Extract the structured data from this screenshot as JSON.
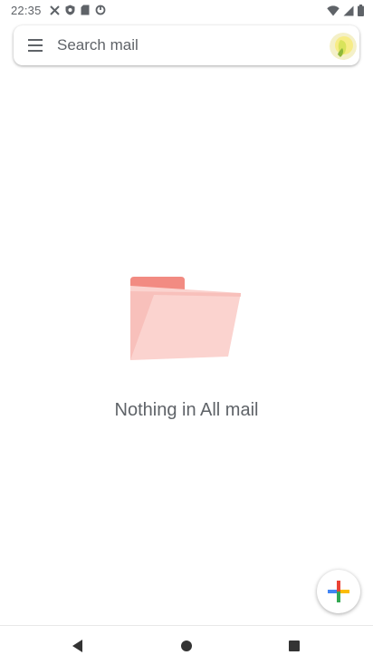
{
  "status_bar": {
    "time": "22:35",
    "left_icons": [
      "missed-call-icon",
      "shield-icon",
      "sd-card-icon",
      "sync-icon"
    ],
    "right_icons": [
      "wifi-icon",
      "signal-icon",
      "battery-icon"
    ]
  },
  "search": {
    "placeholder": "Search mail",
    "menu_icon": "menu-icon",
    "avatar_icon": "account-avatar"
  },
  "empty_state": {
    "message": "Nothing in All mail",
    "illustration": "folder-icon",
    "folder_tab_color": "#f28b82",
    "folder_body_color": "#fbd3cf"
  },
  "fab": {
    "icon": "plus-icon",
    "colors": [
      "#4285f4",
      "#ea4335",
      "#fbbc05",
      "#34a853"
    ]
  },
  "nav_bar": {
    "buttons": [
      "back-icon",
      "home-icon",
      "recents-icon"
    ]
  }
}
